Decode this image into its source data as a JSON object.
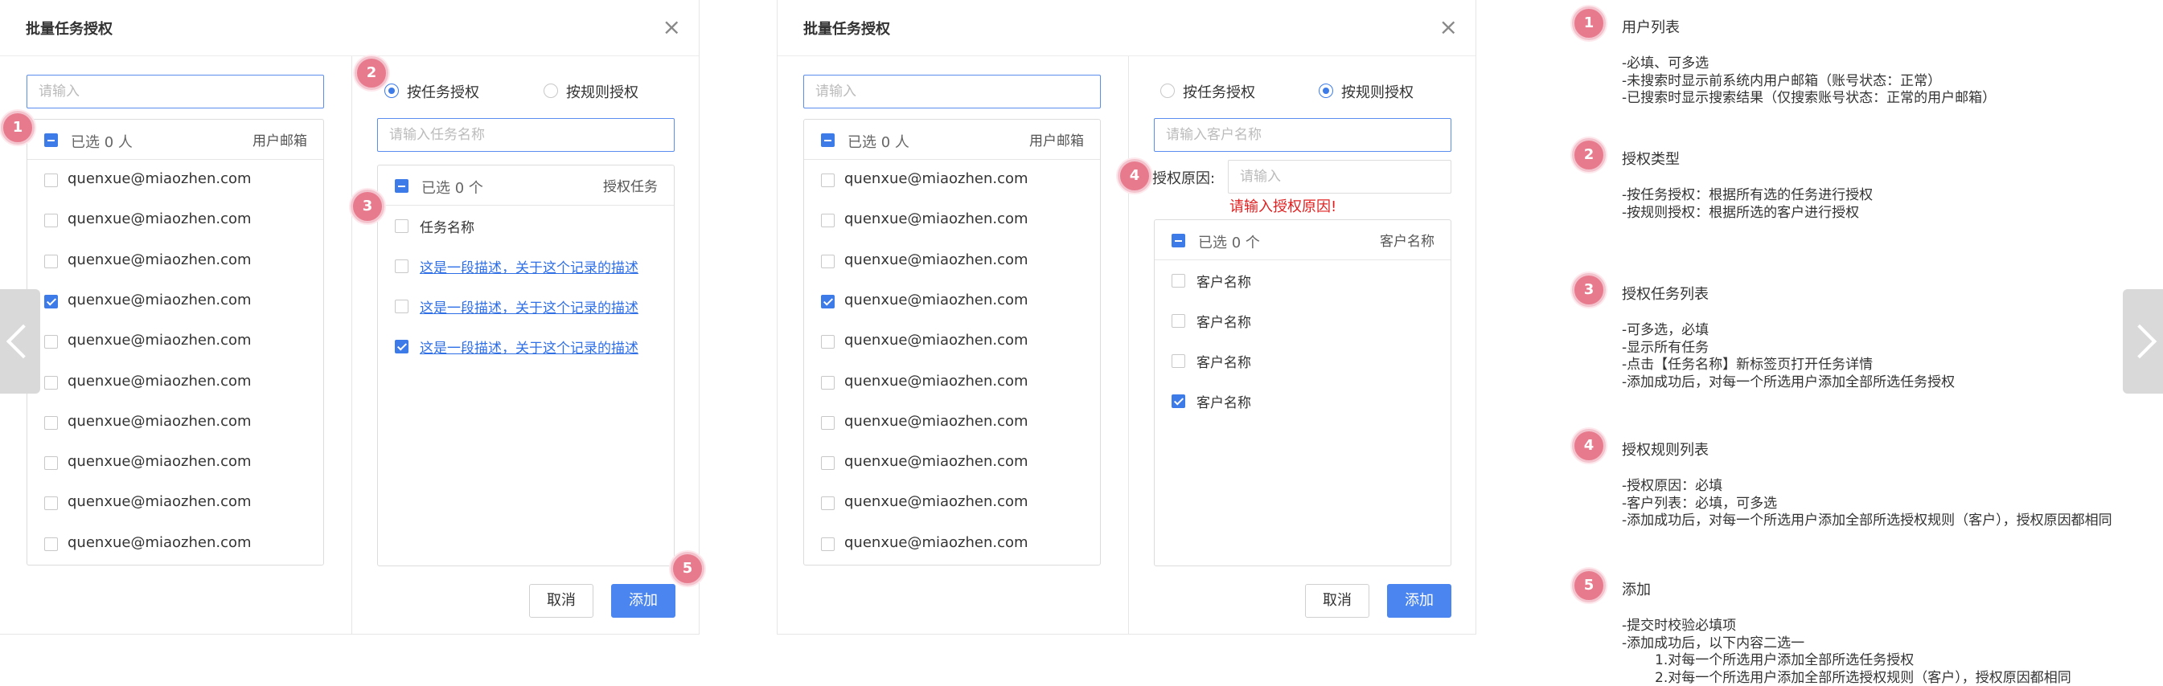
{
  "dialog1": {
    "title": "批量任务授权",
    "close": "×",
    "user_search_placeholder": "请输入",
    "user_panel": {
      "selected_label": "已选 0 人",
      "column": "用户邮箱"
    },
    "users": [
      {
        "email": "quenxue@miaozhen.com",
        "checked": false
      },
      {
        "email": "quenxue@miaozhen.com",
        "checked": false
      },
      {
        "email": "quenxue@miaozhen.com",
        "checked": false
      },
      {
        "email": "quenxue@miaozhen.com",
        "checked": true
      },
      {
        "email": "quenxue@miaozhen.com",
        "checked": false
      },
      {
        "email": "quenxue@miaozhen.com",
        "checked": false
      },
      {
        "email": "quenxue@miaozhen.com",
        "checked": false
      },
      {
        "email": "quenxue@miaozhen.com",
        "checked": false
      },
      {
        "email": "quenxue@miaozhen.com",
        "checked": false
      },
      {
        "email": "quenxue@miaozhen.com",
        "checked": false
      }
    ],
    "radio_task": "按任务授权",
    "radio_rule": "按规则授权",
    "task_search_placeholder": "请输入任务名称",
    "task_panel": {
      "selected_label": "已选 0 个",
      "column": "授权任务"
    },
    "tasks": [
      {
        "name": "任务名称",
        "checked": false,
        "link": false
      },
      {
        "name": "这是一段描述，关于这个记录的描述",
        "checked": false,
        "link": true
      },
      {
        "name": "这是一段描述，关于这个记录的描述",
        "checked": false,
        "link": true
      },
      {
        "name": "这是一段描述，关于这个记录的描述",
        "checked": true,
        "link": true
      }
    ],
    "cancel": "取消",
    "add": "添加"
  },
  "dialog2": {
    "title": "批量任务授权",
    "close": "×",
    "user_search_placeholder": "请输入",
    "user_panel": {
      "selected_label": "已选 0 人",
      "column": "用户邮箱"
    },
    "radio_task": "按任务授权",
    "radio_rule": "按规则授权",
    "client_search_placeholder": "请输入客户名称",
    "reason_label": "授权原因:",
    "reason_placeholder": "请输入",
    "reason_error": "请输入授权原因!",
    "client_panel": {
      "selected_label": "已选 0 个",
      "column": "客户名称"
    },
    "clients": [
      {
        "name": "客户名称",
        "checked": false
      },
      {
        "name": "客户名称",
        "checked": false
      },
      {
        "name": "客户名称",
        "checked": false
      },
      {
        "name": "客户名称",
        "checked": true
      }
    ],
    "cancel": "取消",
    "add": "添加"
  },
  "badges": [
    "1",
    "2",
    "3",
    "4",
    "5"
  ],
  "notes": [
    {
      "num": "1",
      "title": "用户列表",
      "lines": [
        "-必填、可多选",
        "-未搜索时显示前系统内用户邮箱（账号状态：正常）",
        "-已搜索时显示搜索结果（仅搜索账号状态：正常的用户邮箱）"
      ]
    },
    {
      "num": "2",
      "title": "授权类型",
      "lines": [
        "-按任务授权：根据所有选的任务进行授权",
        "-按规则授权：根据所选的客户进行授权"
      ]
    },
    {
      "num": "3",
      "title": "授权任务列表",
      "lines": [
        "-可多选，必填",
        "-显示所有任务",
        "-点击【任务名称】新标签页打开任务详情",
        "-添加成功后，对每一个所选用户添加全部所选任务授权"
      ]
    },
    {
      "num": "4",
      "title": "授权规则列表",
      "lines": [
        "-授权原因：必填",
        "-客户列表：必填，可多选",
        "-添加成功后，对每一个所选用户添加全部所选授权规则（客户），授权原因都相同"
      ]
    },
    {
      "num": "5",
      "title": "添加",
      "lines": [
        "-提交时校验必填项",
        "-添加成功后，以下内容二选一",
        "1.对每一个所选用户添加全部所选任务授权",
        "2.对每一个所选用户添加全部所选授权规则（客户），授权原因都相同"
      ]
    }
  ],
  "colors": {
    "primary": "#4b85f0",
    "badge": "#e87a8e",
    "error": "#e02020"
  }
}
